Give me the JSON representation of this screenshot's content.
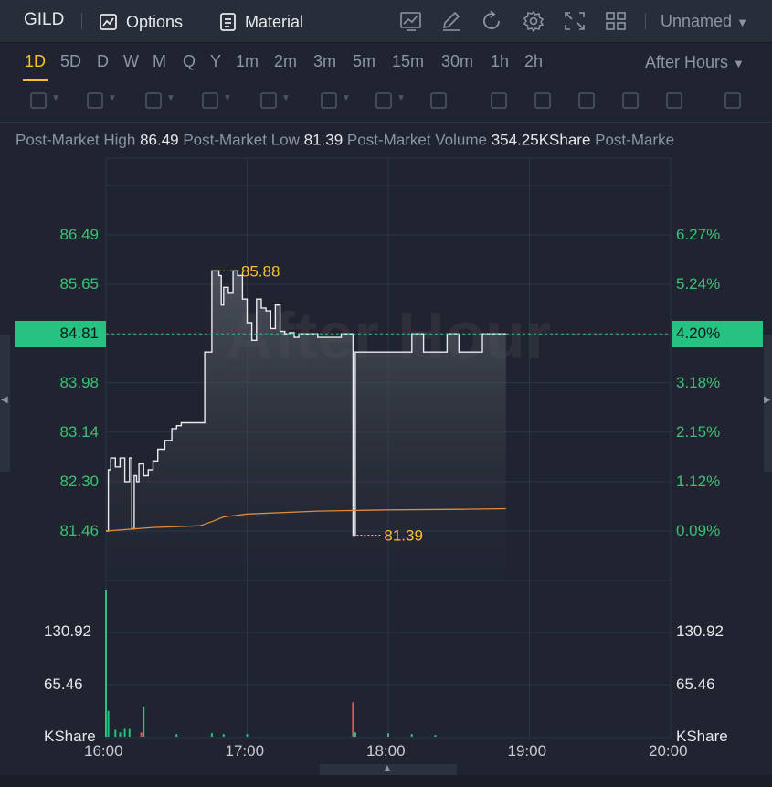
{
  "header": {
    "symbol": "GILD",
    "options_label": "Options",
    "material_label": "Material",
    "layout_name": "Unnamed",
    "toolbar_icons": [
      "chart-settings-icon",
      "edit-icon",
      "refresh-icon",
      "gear-icon",
      "fullscreen-icon",
      "grid-layout-icon"
    ]
  },
  "timeframes": {
    "items": [
      "1D",
      "5D",
      "D",
      "W",
      "M",
      "Q",
      "Y",
      "1m",
      "2m",
      "3m",
      "5m",
      "15m",
      "30m",
      "1h",
      "2h"
    ],
    "active": "1D",
    "session": "After Hours"
  },
  "drawing_tools": [
    "line-tool-icon",
    "rectangle-tool-icon",
    "pattern-tool-icon",
    "fib-tool-icon",
    "arrow-tool-icon",
    "measure-tool-icon",
    "text-tool-icon",
    "bars-tool-icon",
    "pen-icon",
    "lock-icon",
    "eye-icon",
    "magnet-icon",
    "duplicate-icon",
    "trash-icon"
  ],
  "stats": {
    "high_label": "Post-Market High",
    "high_value": "86.49",
    "low_label": "Post-Market Low",
    "low_value": "81.39",
    "volume_label": "Post-Market Volume",
    "volume_value": "354.25KShare",
    "truncated_label": "Post-Marke"
  },
  "watermark": "After Hour",
  "chart_data": {
    "type": "line",
    "price_ticks": [
      "86.49",
      "85.65",
      "84.81",
      "83.98",
      "83.14",
      "82.30",
      "81.46"
    ],
    "percent_ticks": [
      "6.27%",
      "5.24%",
      "4.20%",
      "3.18%",
      "2.15%",
      "1.12%",
      "0.09%"
    ],
    "current_price": "84.81",
    "current_percent": "4.20%",
    "high_marker": "85.88",
    "low_marker": "81.39",
    "x_ticks": [
      "16:00",
      "17:00",
      "18:00",
      "19:00",
      "20:00"
    ],
    "volume_ticks": [
      "130.92",
      "65.46"
    ],
    "volume_unit": "KShare",
    "colors": {
      "price_line": "#e8eaee",
      "avg_line": "#e08a3a",
      "up": "#26c281",
      "down": "#e05a5a",
      "marker": "#f5c12c",
      "axis_text": "#3fbf76"
    },
    "series": [
      {
        "x": [
          "16:00",
          "16:01",
          "16:02",
          "16:04",
          "16:06",
          "16:08",
          "16:10",
          "16:11",
          "16:12",
          "16:13",
          "16:14",
          "16:16",
          "16:18",
          "16:20",
          "16:22",
          "16:25",
          "16:28",
          "16:30",
          "16:32",
          "16:34",
          "16:38",
          "16:42",
          "16:45",
          "16:48",
          "16:49",
          "16:50",
          "16:52",
          "16:54",
          "16:56",
          "16:58",
          "17:00",
          "17:02",
          "17:04",
          "17:06",
          "17:08",
          "17:10",
          "17:12",
          "17:14",
          "17:16",
          "17:18",
          "17:20",
          "17:22",
          "17:25",
          "17:30",
          "17:40",
          "17:45",
          "17:46",
          "17:50",
          "18:00",
          "18:10",
          "18:15",
          "18:25",
          "18:30",
          "18:40",
          "18:50"
        ],
        "y": [
          81.46,
          82.5,
          82.7,
          82.55,
          82.7,
          82.3,
          82.7,
          81.5,
          82.4,
          82.3,
          82.6,
          82.4,
          82.5,
          82.65,
          82.85,
          83.0,
          83.2,
          83.25,
          83.3,
          83.3,
          83.3,
          84.5,
          85.88,
          85.8,
          85.3,
          85.6,
          85.5,
          85.88,
          85.8,
          85.4,
          85.0,
          84.7,
          85.4,
          85.25,
          85.2,
          84.9,
          85.3,
          84.85,
          84.81,
          84.83,
          84.75,
          84.81,
          84.81,
          84.75,
          84.81,
          81.39,
          84.5,
          84.5,
          84.5,
          84.81,
          84.5,
          84.81,
          84.5,
          84.81,
          84.81
        ]
      },
      {
        "name": "avg",
        "x": [
          "16:00",
          "16:20",
          "16:40",
          "16:45",
          "16:50",
          "17:00",
          "17:30",
          "18:00",
          "18:30",
          "18:50"
        ],
        "y": [
          81.46,
          81.52,
          81.55,
          81.62,
          81.7,
          81.75,
          81.8,
          81.82,
          81.83,
          81.84
        ]
      }
    ],
    "volume_series": {
      "x": [
        "16:00",
        "16:01",
        "16:04",
        "16:06",
        "16:08",
        "16:10",
        "16:15",
        "16:16",
        "16:30",
        "16:45",
        "16:50",
        "17:00",
        "17:45",
        "17:46",
        "18:00",
        "18:10",
        "18:20"
      ],
      "values": [
        170,
        30,
        8,
        5,
        10,
        10,
        5,
        35,
        3,
        4,
        3,
        3,
        40,
        5,
        4,
        3,
        2
      ],
      "up": [
        true,
        true,
        true,
        true,
        true,
        true,
        false,
        true,
        true,
        true,
        true,
        true,
        false,
        true,
        true,
        true,
        true
      ]
    }
  }
}
